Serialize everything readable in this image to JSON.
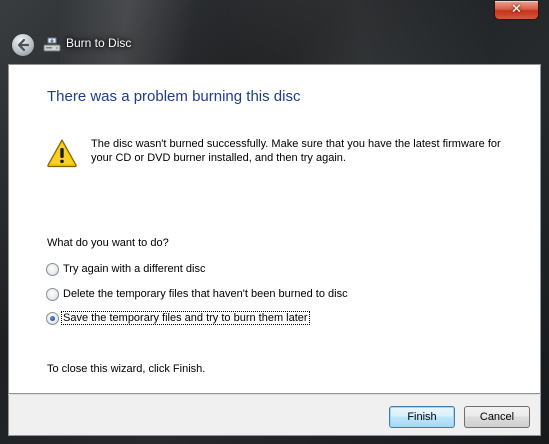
{
  "window": {
    "title": "Burn to Disc",
    "close_glyph": "✕"
  },
  "content": {
    "heading": "There was a problem burning this disc",
    "message": "The disc wasn't burned successfully. Make sure that you have the latest firmware for your CD or DVD burner installed, and then try again.",
    "question": "What do you want to do?",
    "options": [
      {
        "label": "Try again with a different disc",
        "selected": false
      },
      {
        "label": "Delete the temporary files that haven't been burned to disc",
        "selected": false
      },
      {
        "label": "Save the temporary files and try to burn them later",
        "selected": true
      }
    ],
    "close_hint": "To close this wizard, click Finish."
  },
  "footer": {
    "finish_label": "Finish",
    "cancel_label": "Cancel"
  },
  "icons": {
    "back": "back-arrow-icon",
    "title": "burn-disc-icon",
    "warning": "warning-icon",
    "close": "close-icon"
  },
  "colors": {
    "heading": "#1e3d8a",
    "close_button": "#c4331b",
    "warning_fill": "#f5c400"
  }
}
